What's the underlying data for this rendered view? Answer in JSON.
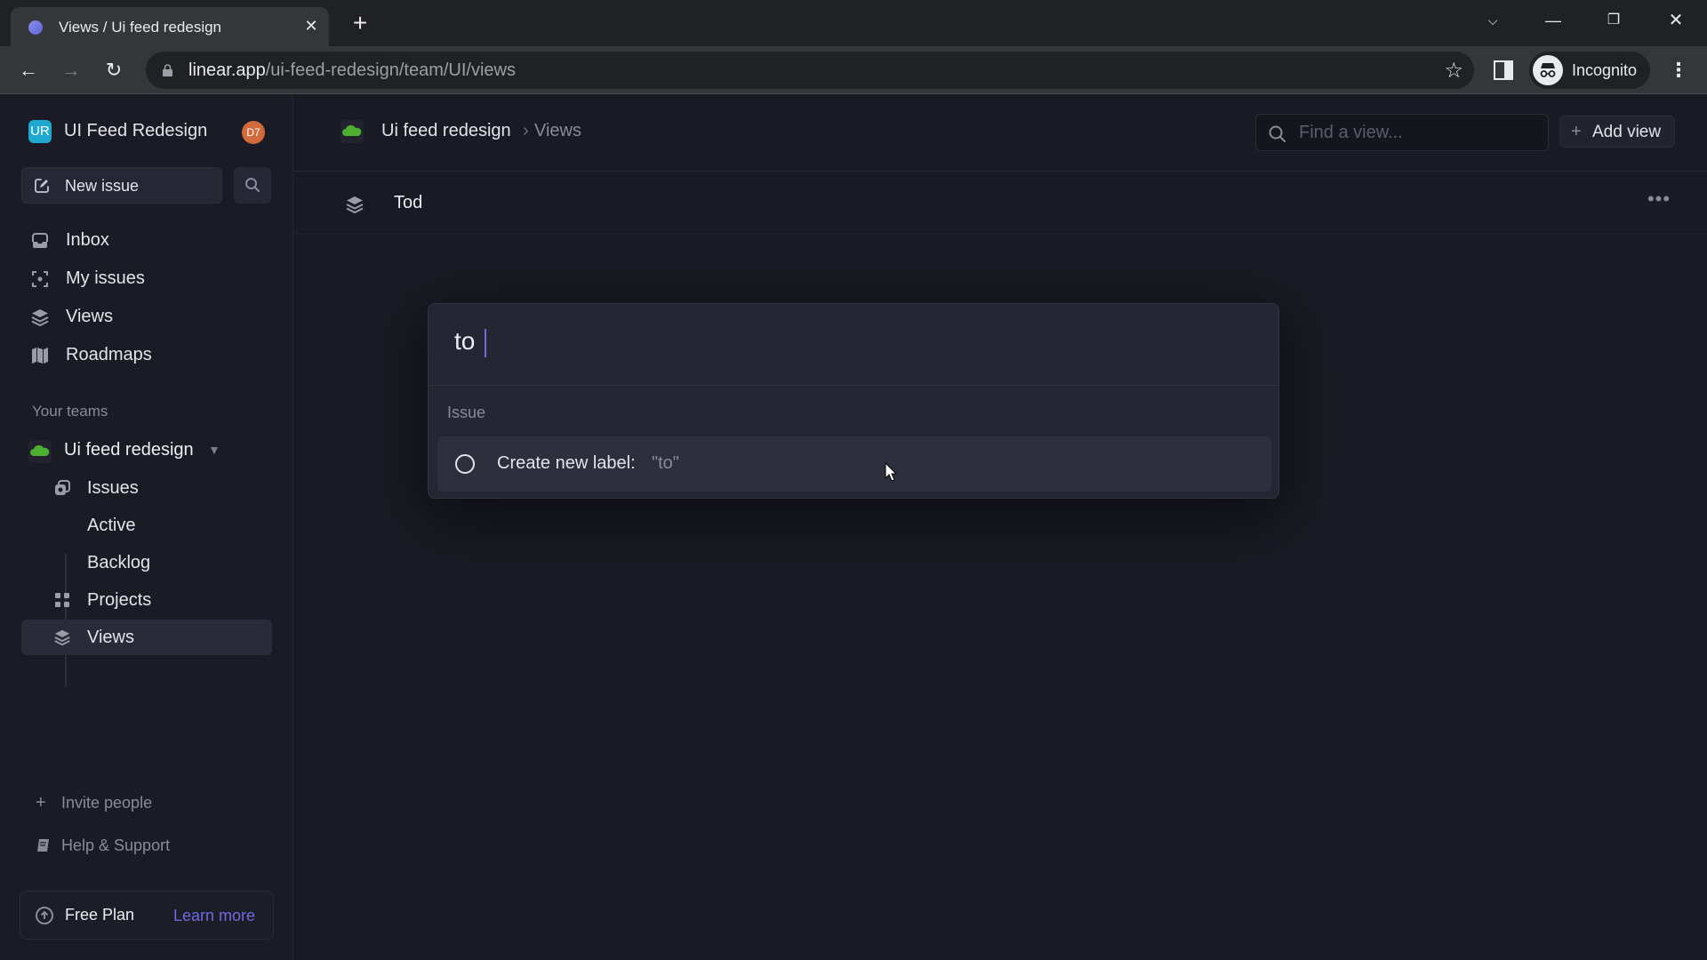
{
  "browser": {
    "tab_title": "Views / Ui feed redesign",
    "url_host": "linear.app",
    "url_path": "/ui-feed-redesign/team/UI/views",
    "profile_label": "Incognito"
  },
  "workspace": {
    "logo_initials": "UR",
    "name": "UI Feed Redesign",
    "user_avatar": "D7",
    "logo_color": "#1fa8cf",
    "avatar_color": "#d26a3c"
  },
  "sidebar": {
    "new_issue_label": "New issue",
    "nav": [
      {
        "label": "Inbox",
        "icon": "inbox-icon"
      },
      {
        "label": "My issues",
        "icon": "my-issues-icon"
      },
      {
        "label": "Views",
        "icon": "views-icon"
      },
      {
        "label": "Roadmaps",
        "icon": "roadmap-icon"
      }
    ],
    "teams_section_label": "Your teams",
    "team": {
      "name": "Ui feed redesign",
      "items": [
        {
          "label": "Issues"
        },
        {
          "label": "Active"
        },
        {
          "label": "Backlog"
        },
        {
          "label": "Projects"
        },
        {
          "label": "Views",
          "active": true
        }
      ]
    },
    "invite_label": "Invite people",
    "help_label": "Help & Support",
    "plan_label": "Free Plan",
    "plan_link": "Learn more"
  },
  "header": {
    "breadcrumb_team": "Ui feed redesign",
    "breadcrumb_separator": "›",
    "breadcrumb_page": "Views",
    "search_placeholder": "Find a view...",
    "add_view_label": "Add view"
  },
  "views_list": [
    {
      "label": "Tod"
    }
  ],
  "palette": {
    "query": "to",
    "group_label": "Issue",
    "option_label": "Create new label:",
    "option_value": "\"to\""
  },
  "colors": {
    "accent": "#6e6be0",
    "team_green": "#4caf30"
  }
}
